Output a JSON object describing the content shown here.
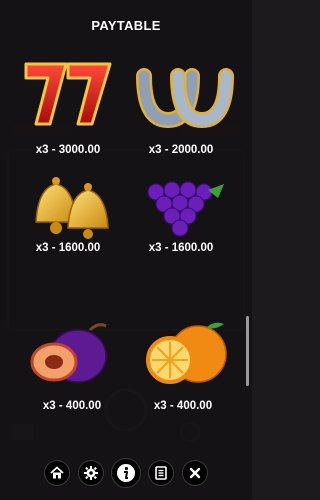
{
  "header": {
    "title": "PAYTABLE"
  },
  "symbols": [
    {
      "icon": "seven-icon",
      "payout": "x3 - 3000.00"
    },
    {
      "icon": "horseshoe-icon",
      "payout": "x3 - 2000.00"
    },
    {
      "icon": "bells-icon",
      "payout": "x3 - 1600.00"
    },
    {
      "icon": "grapes-icon",
      "payout": "x3 - 1600.00"
    },
    {
      "icon": "plum-icon",
      "payout": "x3 - 400.00"
    },
    {
      "icon": "orange-icon",
      "payout": "x3 - 400.00"
    }
  ],
  "nav": [
    {
      "icon": "home-icon"
    },
    {
      "icon": "settings-icon"
    },
    {
      "icon": "info-icon",
      "active": true
    },
    {
      "icon": "history-icon"
    },
    {
      "icon": "close-icon"
    }
  ],
  "colors": {
    "background": "#1d1a1d",
    "seven_red": "#d01818",
    "gold": "#f2c84b",
    "grape_purple": "#6a1fb8",
    "orange": "#f08a12"
  }
}
